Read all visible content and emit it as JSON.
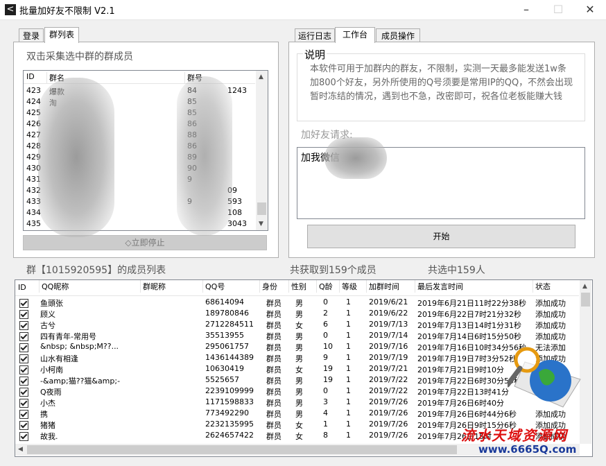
{
  "window": {
    "title": "批量加好友不限制 V2.1",
    "icon": "back-arrow-icon"
  },
  "left_tabs": [
    "登录",
    "群列表"
  ],
  "right_tabs": [
    "运行日志",
    "工作台",
    "成员操作"
  ],
  "group_panel": {
    "label": "双击采集选中群的群成员",
    "columns": [
      "ID",
      "群名",
      "群号"
    ],
    "rows": [
      {
        "id": "423",
        "name": "爆款",
        "number": "84",
        "extra": "1243"
      },
      {
        "id": "424",
        "name": "淘",
        "number": "85",
        "extra": ""
      },
      {
        "id": "425",
        "name": "",
        "number": "85",
        "extra": ""
      },
      {
        "id": "426",
        "name": "",
        "number": "86",
        "extra": ""
      },
      {
        "id": "427",
        "name": "",
        "number": "88",
        "extra": ""
      },
      {
        "id": "428",
        "name": "",
        "number": "86",
        "extra": ""
      },
      {
        "id": "429",
        "name": "",
        "number": "89",
        "extra": ""
      },
      {
        "id": "430",
        "name": "",
        "number": "90",
        "extra": ""
      },
      {
        "id": "431",
        "name": "",
        "number": "9",
        "extra": ""
      },
      {
        "id": "432",
        "name": "",
        "number": "",
        "extra": "09"
      },
      {
        "id": "433",
        "name": "",
        "number": "9",
        "extra": "593"
      },
      {
        "id": "434",
        "name": "",
        "number": "",
        "extra": "108"
      },
      {
        "id": "435",
        "name": "",
        "number": "",
        "extra": "3043"
      }
    ],
    "stop_button": "◇立即停止"
  },
  "work_panel": {
    "desc_label": "说明",
    "desc_text": "本软件可用于加群内的群友，不限制，实测一天最多能发送1w条加800个好友，另外所使用的Q号须要是常用IP的QQ，不然会出现暂时冻结的情况，遇到也不急，改密即可，祝各位老板能赚大钱",
    "request_label": "加好友请求:",
    "request_value": "加我微信",
    "start_button": "开始"
  },
  "status": {
    "group_list_title": "群【1015920595】的成员列表",
    "fetched": "共获取到159个成员",
    "selected": "共选中159人"
  },
  "members": {
    "columns": [
      "ID",
      "QQ昵称",
      "群昵称",
      "QQ号",
      "身份",
      "性别",
      "Q龄",
      "等级",
      "加群时间",
      "最后发言时间",
      "状态"
    ],
    "rows": [
      {
        "nick": "鱼頭张",
        "card": "",
        "qq": "68614094",
        "role": "群员",
        "sex": "男",
        "age": "0",
        "level": "1",
        "join": "2019/6/21",
        "last": "2019年6月21日11时22分38秒",
        "state": "添加成功"
      },
      {
        "nick": "顾义",
        "card": "",
        "qq": "189780846",
        "role": "群员",
        "sex": "男",
        "age": "2",
        "level": "1",
        "join": "2019/6/22",
        "last": "2019年6月22日7时21分32秒",
        "state": "添加成功"
      },
      {
        "nick": "古兮",
        "card": "",
        "qq": "2712284511",
        "role": "群员",
        "sex": "女",
        "age": "6",
        "level": "1",
        "join": "2019/7/13",
        "last": "2019年7月13日14时1分31秒",
        "state": "添加成功"
      },
      {
        "nick": "四有青年-常用号",
        "card": "",
        "qq": "35513955",
        "role": "群员",
        "sex": "男",
        "age": "0",
        "level": "1",
        "join": "2019/7/14",
        "last": "2019年7月14日6时15分50秒",
        "state": "添加成功"
      },
      {
        "nick": "  &nbsp;  &nbsp;M??...",
        "card": "",
        "qq": "295061757",
        "role": "群员",
        "sex": "男",
        "age": "10",
        "level": "1",
        "join": "2019/7/16",
        "last": "2019年7月16日10时34分56秒",
        "state": "无法添加"
      },
      {
        "nick": "山水有相逢",
        "card": "",
        "qq": "1436144389",
        "role": "群员",
        "sex": "男",
        "age": "9",
        "level": "1",
        "join": "2019/7/19",
        "last": "2019年7月19日7时3分52秒",
        "state": "添加成功"
      },
      {
        "nick": "小柯南",
        "card": "",
        "qq": "10630419",
        "role": "群员",
        "sex": "女",
        "age": "19",
        "level": "1",
        "join": "2019/7/21",
        "last": "2019年7月21日9时10分",
        "state": ""
      },
      {
        "nick": "-&amp;猫??猫&amp;-",
        "card": "",
        "qq": "5525657",
        "role": "群员",
        "sex": "男",
        "age": "19",
        "level": "1",
        "join": "2019/7/22",
        "last": "2019年7月22日6时30分55秒",
        "state": ""
      },
      {
        "nick": "Q夜雨",
        "card": "",
        "qq": "2239109999",
        "role": "群员",
        "sex": "男",
        "age": "0",
        "level": "1",
        "join": "2019/7/22",
        "last": "2019年7月22日13时41分",
        "state": ""
      },
      {
        "nick": "小杰",
        "card": "",
        "qq": "1171598833",
        "role": "群员",
        "sex": "男",
        "age": "3",
        "level": "1",
        "join": "2019/7/26",
        "last": "2019年7月26日6时40分",
        "state": ""
      },
      {
        "nick": "携",
        "card": "",
        "qq": "773492290",
        "role": "群员",
        "sex": "男",
        "age": "4",
        "level": "1",
        "join": "2019/7/26",
        "last": "2019年7月26日6时44分6秒",
        "state": "添加成功"
      },
      {
        "nick": "猪猪",
        "card": "",
        "qq": "2232135995",
        "role": "群员",
        "sex": "女",
        "age": "1",
        "level": "1",
        "join": "2019/7/26",
        "last": "2019年7月26日9时15分6秒",
        "state": "添加成功"
      },
      {
        "nick": "故我.",
        "card": "",
        "qq": "2624657422",
        "role": "群员",
        "sex": "女",
        "age": "8",
        "level": "1",
        "join": "2019/7/26",
        "last": "2019年7月26日15时",
        "state": "添加成功"
      }
    ]
  },
  "watermark": {
    "site_name": "流水天域资源网",
    "url": "www.6665Q.com"
  }
}
